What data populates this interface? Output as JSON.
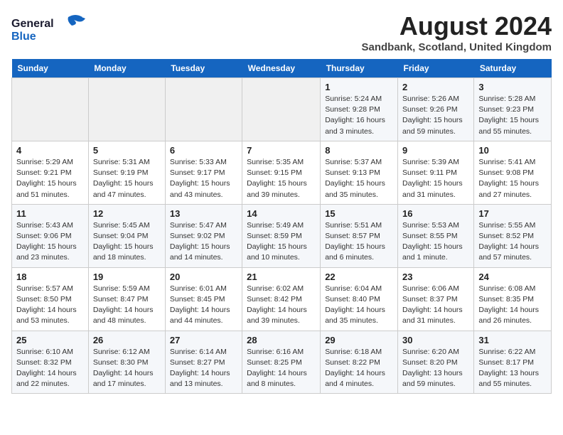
{
  "header": {
    "logo_line1": "General",
    "logo_line2": "Blue",
    "month_title": "August 2024",
    "location": "Sandbank, Scotland, United Kingdom"
  },
  "weekdays": [
    "Sunday",
    "Monday",
    "Tuesday",
    "Wednesday",
    "Thursday",
    "Friday",
    "Saturday"
  ],
  "weeks": [
    [
      {
        "day": "",
        "detail": ""
      },
      {
        "day": "",
        "detail": ""
      },
      {
        "day": "",
        "detail": ""
      },
      {
        "day": "",
        "detail": ""
      },
      {
        "day": "1",
        "detail": "Sunrise: 5:24 AM\nSunset: 9:28 PM\nDaylight: 16 hours\nand 3 minutes."
      },
      {
        "day": "2",
        "detail": "Sunrise: 5:26 AM\nSunset: 9:26 PM\nDaylight: 15 hours\nand 59 minutes."
      },
      {
        "day": "3",
        "detail": "Sunrise: 5:28 AM\nSunset: 9:23 PM\nDaylight: 15 hours\nand 55 minutes."
      }
    ],
    [
      {
        "day": "4",
        "detail": "Sunrise: 5:29 AM\nSunset: 9:21 PM\nDaylight: 15 hours\nand 51 minutes."
      },
      {
        "day": "5",
        "detail": "Sunrise: 5:31 AM\nSunset: 9:19 PM\nDaylight: 15 hours\nand 47 minutes."
      },
      {
        "day": "6",
        "detail": "Sunrise: 5:33 AM\nSunset: 9:17 PM\nDaylight: 15 hours\nand 43 minutes."
      },
      {
        "day": "7",
        "detail": "Sunrise: 5:35 AM\nSunset: 9:15 PM\nDaylight: 15 hours\nand 39 minutes."
      },
      {
        "day": "8",
        "detail": "Sunrise: 5:37 AM\nSunset: 9:13 PM\nDaylight: 15 hours\nand 35 minutes."
      },
      {
        "day": "9",
        "detail": "Sunrise: 5:39 AM\nSunset: 9:11 PM\nDaylight: 15 hours\nand 31 minutes."
      },
      {
        "day": "10",
        "detail": "Sunrise: 5:41 AM\nSunset: 9:08 PM\nDaylight: 15 hours\nand 27 minutes."
      }
    ],
    [
      {
        "day": "11",
        "detail": "Sunrise: 5:43 AM\nSunset: 9:06 PM\nDaylight: 15 hours\nand 23 minutes."
      },
      {
        "day": "12",
        "detail": "Sunrise: 5:45 AM\nSunset: 9:04 PM\nDaylight: 15 hours\nand 18 minutes."
      },
      {
        "day": "13",
        "detail": "Sunrise: 5:47 AM\nSunset: 9:02 PM\nDaylight: 15 hours\nand 14 minutes."
      },
      {
        "day": "14",
        "detail": "Sunrise: 5:49 AM\nSunset: 8:59 PM\nDaylight: 15 hours\nand 10 minutes."
      },
      {
        "day": "15",
        "detail": "Sunrise: 5:51 AM\nSunset: 8:57 PM\nDaylight: 15 hours\nand 6 minutes."
      },
      {
        "day": "16",
        "detail": "Sunrise: 5:53 AM\nSunset: 8:55 PM\nDaylight: 15 hours\nand 1 minute."
      },
      {
        "day": "17",
        "detail": "Sunrise: 5:55 AM\nSunset: 8:52 PM\nDaylight: 14 hours\nand 57 minutes."
      }
    ],
    [
      {
        "day": "18",
        "detail": "Sunrise: 5:57 AM\nSunset: 8:50 PM\nDaylight: 14 hours\nand 53 minutes."
      },
      {
        "day": "19",
        "detail": "Sunrise: 5:59 AM\nSunset: 8:47 PM\nDaylight: 14 hours\nand 48 minutes."
      },
      {
        "day": "20",
        "detail": "Sunrise: 6:01 AM\nSunset: 8:45 PM\nDaylight: 14 hours\nand 44 minutes."
      },
      {
        "day": "21",
        "detail": "Sunrise: 6:02 AM\nSunset: 8:42 PM\nDaylight: 14 hours\nand 39 minutes."
      },
      {
        "day": "22",
        "detail": "Sunrise: 6:04 AM\nSunset: 8:40 PM\nDaylight: 14 hours\nand 35 minutes."
      },
      {
        "day": "23",
        "detail": "Sunrise: 6:06 AM\nSunset: 8:37 PM\nDaylight: 14 hours\nand 31 minutes."
      },
      {
        "day": "24",
        "detail": "Sunrise: 6:08 AM\nSunset: 8:35 PM\nDaylight: 14 hours\nand 26 minutes."
      }
    ],
    [
      {
        "day": "25",
        "detail": "Sunrise: 6:10 AM\nSunset: 8:32 PM\nDaylight: 14 hours\nand 22 minutes."
      },
      {
        "day": "26",
        "detail": "Sunrise: 6:12 AM\nSunset: 8:30 PM\nDaylight: 14 hours\nand 17 minutes."
      },
      {
        "day": "27",
        "detail": "Sunrise: 6:14 AM\nSunset: 8:27 PM\nDaylight: 14 hours\nand 13 minutes."
      },
      {
        "day": "28",
        "detail": "Sunrise: 6:16 AM\nSunset: 8:25 PM\nDaylight: 14 hours\nand 8 minutes."
      },
      {
        "day": "29",
        "detail": "Sunrise: 6:18 AM\nSunset: 8:22 PM\nDaylight: 14 hours\nand 4 minutes."
      },
      {
        "day": "30",
        "detail": "Sunrise: 6:20 AM\nSunset: 8:20 PM\nDaylight: 13 hours\nand 59 minutes."
      },
      {
        "day": "31",
        "detail": "Sunrise: 6:22 AM\nSunset: 8:17 PM\nDaylight: 13 hours\nand 55 minutes."
      }
    ]
  ]
}
